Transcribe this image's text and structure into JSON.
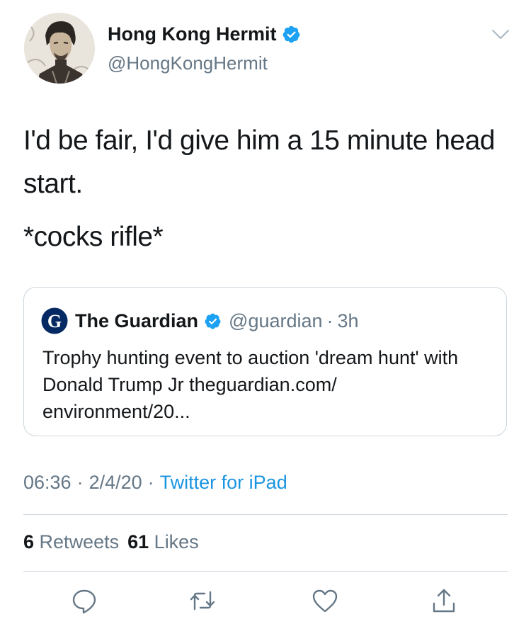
{
  "author": {
    "display_name": "Hong Kong Hermit",
    "handle": "@HongKongHermit",
    "verified": true,
    "avatar_icon": "avatar-portrait"
  },
  "tweet": {
    "paragraphs": [
      "I'd be fair, I'd give him a 15 minute head start.",
      "*cocks rifle*"
    ]
  },
  "quoted_tweet": {
    "logo_icon": "guardian-g-logo",
    "display_name": "The Guardian",
    "handle": "@guardian",
    "separator": "·",
    "time": "3h",
    "text": "Trophy hunting event to auction 'dream hunt' with Donald Trump Jr theguardian.com/ environment/20..."
  },
  "meta": {
    "time": "06:36",
    "separator": "·",
    "date": "2/4/20",
    "source": "Twitter for iPad"
  },
  "stats": {
    "retweets_count": "6",
    "retweets_label": "Retweets",
    "likes_count": "61",
    "likes_label": "Likes"
  },
  "actions": [
    {
      "name": "reply-icon"
    },
    {
      "name": "retweet-icon"
    },
    {
      "name": "like-icon"
    },
    {
      "name": "share-icon"
    }
  ],
  "colors": {
    "verified_blue": "#1da1f2",
    "secondary_text": "#657786",
    "link_blue": "#1b95e0",
    "border": "#ccd6dd",
    "guardian_navy": "#052962"
  }
}
